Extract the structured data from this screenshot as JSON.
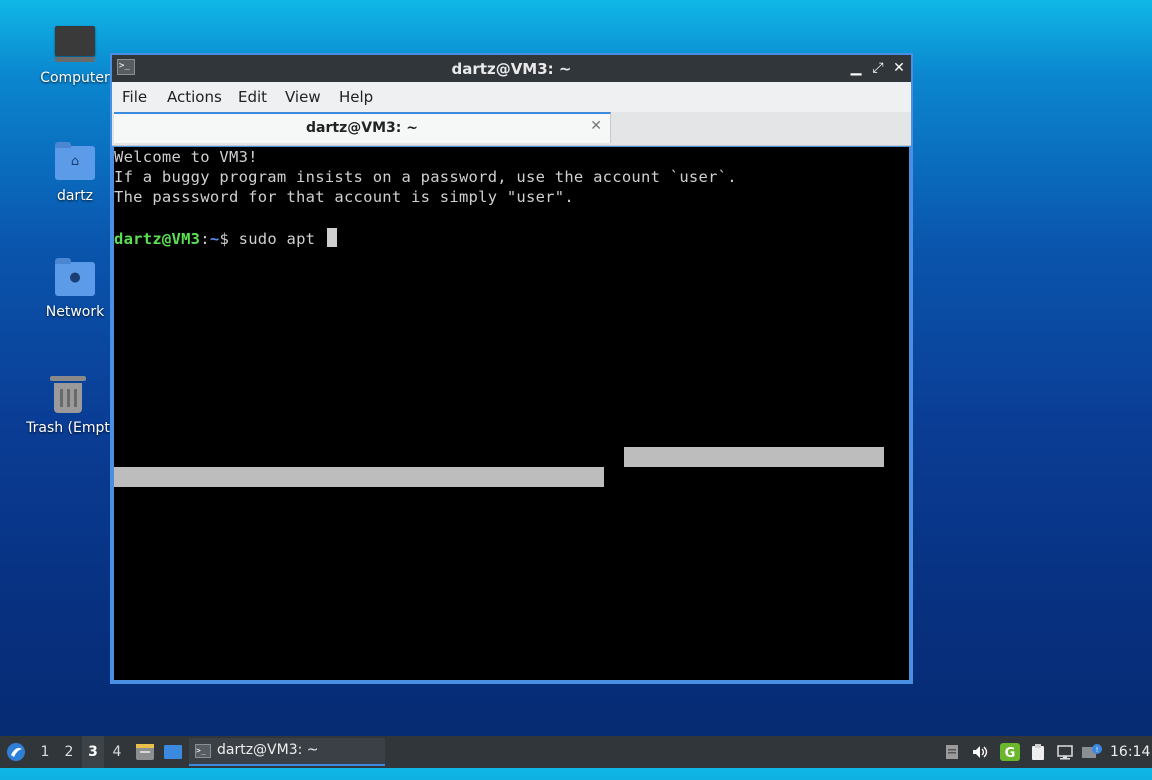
{
  "desktop": {
    "icons": [
      {
        "label": "Computer"
      },
      {
        "label": "dartz"
      },
      {
        "label": "Network"
      },
      {
        "label": "Trash (Empt"
      }
    ]
  },
  "window": {
    "title": "dartz@VM3: ~",
    "controls": {
      "minimize": "▁",
      "maximize": "⤢",
      "close": "✕"
    },
    "menu": [
      "File",
      "Actions",
      "Edit",
      "View",
      "Help"
    ],
    "tab": {
      "label": "dartz@VM3: ~",
      "close": "✕"
    }
  },
  "terminal": {
    "lines": [
      "Welcome to VM3!",
      "If a buggy program insists on a password, use the account `user`.",
      "The passsword for that account is simply \"user\"."
    ],
    "prompt": {
      "user_host": "dartz@VM3",
      "sep": ":",
      "path": "~",
      "symbol": "$",
      "command": " sudo apt "
    }
  },
  "taskbar": {
    "workspaces": [
      "1",
      "2",
      "3",
      "4"
    ],
    "active_workspace": "3",
    "task_label": "dartz@VM3: ~",
    "clock": "16:14"
  },
  "colors": {
    "accent": "#4a90e2",
    "prompt_user": "#5be052",
    "prompt_path": "#5c8fe8",
    "terminal_bg": "#000000",
    "taskbar_bg": "#31363b"
  }
}
